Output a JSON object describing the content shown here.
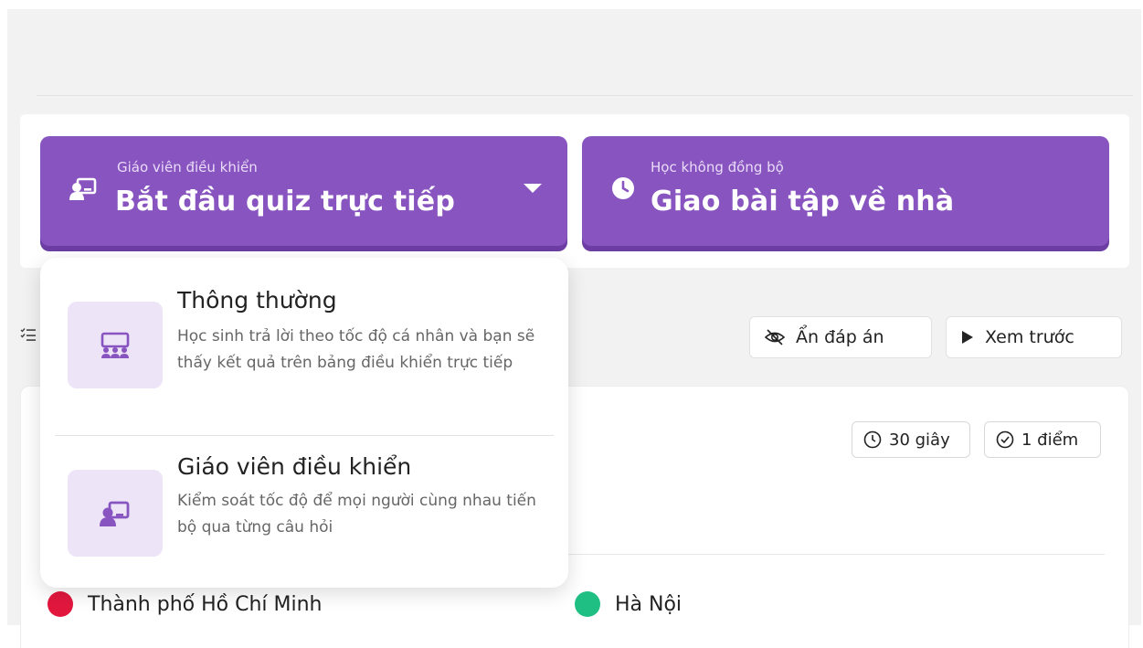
{
  "launch": {
    "live": {
      "small_label": "Giáo viên điều khiển",
      "big_label": "Bắt đầu quiz trực tiếp",
      "icon": "presenter-icon"
    },
    "async": {
      "small_label": "Học không đồng bộ",
      "big_label": "Giao bài tập về nhà",
      "icon": "clock-icon"
    }
  },
  "mode_dropdown": {
    "items": [
      {
        "title": "Thông thường",
        "description": "Học sinh trả lời theo tốc độ cá nhân và bạn sẽ thấy kết quả trên bảng điều khiển trực tiếp",
        "icon": "classroom-icon"
      },
      {
        "title": "Giáo viên điều khiển",
        "description": "Kiểm soát tốc độ để mọi người cùng nhau tiến bộ qua từng câu hỏi",
        "icon": "presenter-icon"
      }
    ]
  },
  "toolbar": {
    "hide_answers_label": "Ẩn đáp án",
    "preview_label": "Xem trước"
  },
  "question": {
    "time_label": "30 giây",
    "points_label": "1 điểm",
    "answers": [
      {
        "text": "Thành phố Hồ Chí Minh",
        "color": "#e2173e"
      },
      {
        "text": "Hà Nội",
        "color": "#1fbf84"
      }
    ]
  },
  "colors": {
    "accent": "#8854c0",
    "accent_shadow": "#6c3da3",
    "tile_bg": "#ede4f8"
  }
}
